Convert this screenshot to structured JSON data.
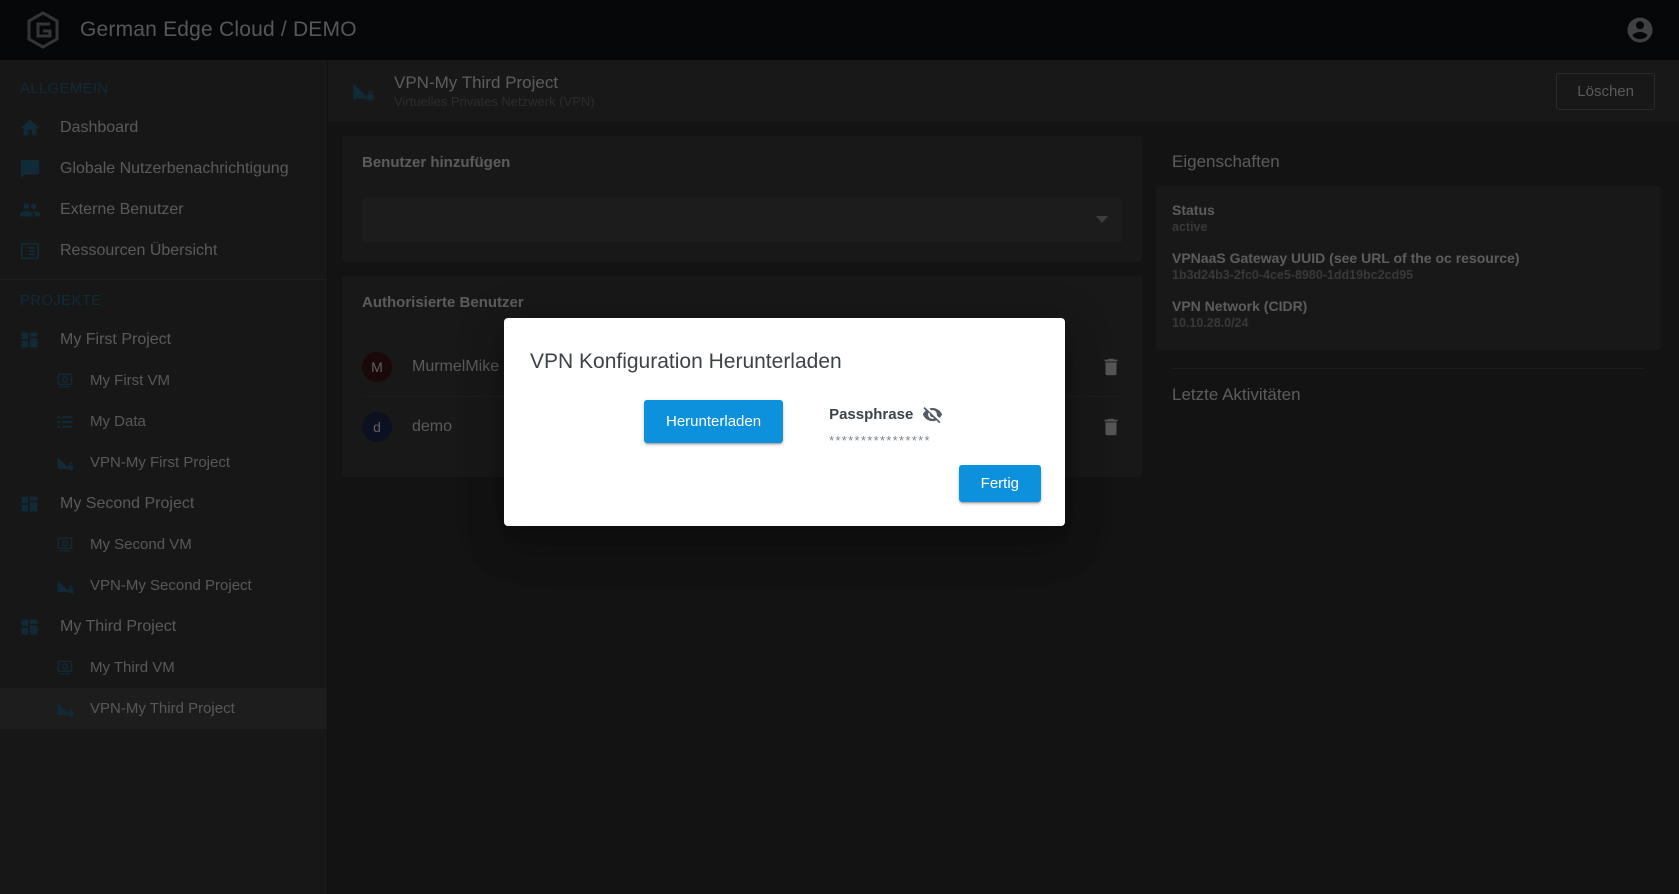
{
  "topbar": {
    "logo_icon": "ge-hexagon-logo-icon",
    "title": "German Edge Cloud / DEMO",
    "account_icon": "account-circle-icon"
  },
  "sidebar": {
    "general_label": "ALLGEMEIN",
    "projects_label": "PROJEKTE",
    "general_items": [
      {
        "label": "Dashboard",
        "icon": "home-icon"
      },
      {
        "label": "Globale Nutzerbenachrichtigung",
        "icon": "message-icon"
      },
      {
        "label": "Externe Benutzer",
        "icon": "people-icon"
      },
      {
        "label": "Ressourcen Übersicht",
        "icon": "list-table-icon"
      }
    ],
    "projects": [
      {
        "label": "My First Project",
        "icon": "project-grid-icon",
        "level": "parent",
        "selected": false
      },
      {
        "label": "My First VM",
        "icon": "vm-icon",
        "level": "child",
        "selected": false
      },
      {
        "label": "My Data",
        "icon": "data-list-icon",
        "level": "child",
        "selected": false
      },
      {
        "label": "VPN-My First Project",
        "icon": "vpn-lock-icon",
        "level": "child",
        "selected": false
      },
      {
        "label": "My Second Project",
        "icon": "project-grid-icon",
        "level": "parent",
        "selected": false
      },
      {
        "label": "My Second VM",
        "icon": "vm-icon",
        "level": "child",
        "selected": false
      },
      {
        "label": "VPN-My Second Project",
        "icon": "vpn-lock-icon",
        "level": "child",
        "selected": false
      },
      {
        "label": "My Third Project",
        "icon": "project-grid-icon",
        "level": "parent",
        "selected": false
      },
      {
        "label": "My Third VM",
        "icon": "vm-icon",
        "level": "child",
        "selected": false
      },
      {
        "label": "VPN-My Third Project",
        "icon": "vpn-lock-icon",
        "level": "child",
        "selected": true
      }
    ]
  },
  "page_header": {
    "icon": "vpn-lock-icon",
    "title": "VPN-My Third Project",
    "subtitle": "Virtuelles Privates Netzwerk (VPN)",
    "delete_label": "Löschen"
  },
  "add_user_card": {
    "title": "Benutzer hinzufügen",
    "select_value": "",
    "select_placeholder": "",
    "caret_icon": "chevron-down-icon"
  },
  "authorized_users_card": {
    "title": "Authorisierte Benutzer",
    "users": [
      {
        "initial": "M",
        "name": "MurmelMike",
        "avatar_color": "#4d1417",
        "delete_icon": "trash-icon"
      },
      {
        "initial": "d",
        "name": "demo",
        "avatar_color": "#1b2a63",
        "delete_icon": "trash-icon"
      }
    ]
  },
  "properties": {
    "heading": "Eigenschaften",
    "rows": [
      {
        "key": "Status",
        "value": "active"
      },
      {
        "key": "VPNaaS Gateway UUID (see URL of the oc resource)",
        "value": "1b3d24b3-2fc0-4ce5-8980-1dd19bc2cd95"
      },
      {
        "key": "VPN Network (CIDR)",
        "value": "10.10.28.0/24"
      }
    ],
    "activities_heading": "Letzte Aktivitäten"
  },
  "modal": {
    "title": "VPN Konfiguration Herunterladen",
    "download_label": "Herunterladen",
    "passphrase_label": "Passphrase",
    "passphrase_toggle_icon": "eye-off-icon",
    "passphrase_masked": "****************",
    "done_label": "Fertig"
  },
  "colors": {
    "accent_blue": "#0d91dd",
    "sidebar_icon_blue": "#1a6b99",
    "section_label_blue": "#1b6a96",
    "topbar_bg": "#101418",
    "sidebar_bg": "#3a3a3a",
    "content_bg": "#303030",
    "card_bg": "#3b3b3b"
  }
}
